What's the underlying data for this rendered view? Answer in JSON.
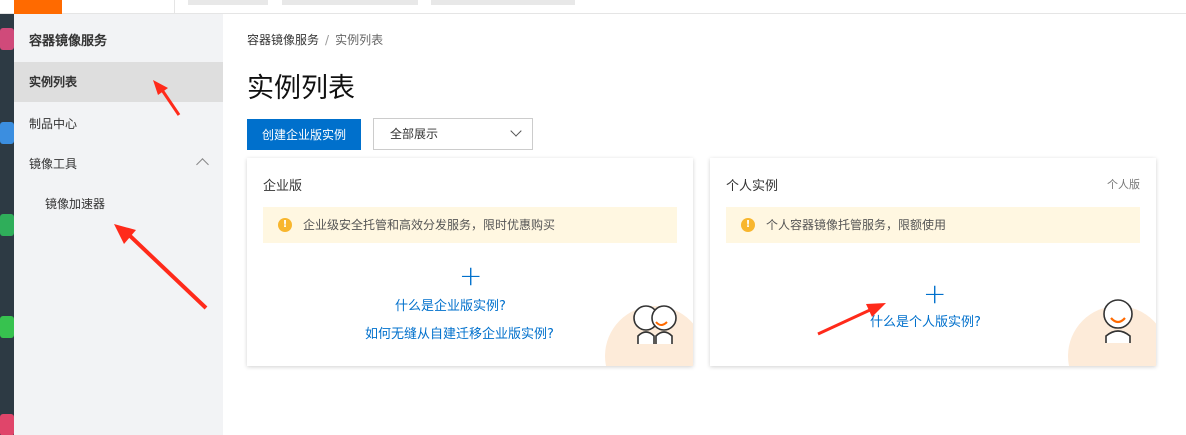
{
  "sidebar": {
    "title": "容器镜像服务",
    "items": [
      {
        "label": "实例列表",
        "active": true
      },
      {
        "label": "制品中心"
      },
      {
        "label": "镜像工具",
        "expanded": true
      },
      {
        "label": "镜像加速器",
        "sub": true
      }
    ]
  },
  "breadcrumb": {
    "root": "容器镜像服务",
    "current": "实例列表"
  },
  "page": {
    "title": "实例列表"
  },
  "toolbar": {
    "create_label": "创建企业版实例",
    "filter_value": "全部展示"
  },
  "cards": {
    "enterprise": {
      "title": "企业版",
      "notice": "企业级安全托管和高效分发服务，限时优惠购买",
      "links": [
        "什么是企业版实例?",
        "如何无缝从自建迁移企业版实例?"
      ]
    },
    "personal": {
      "title": "个人实例",
      "tag": "个人版",
      "notice": "个人容器镜像托管服务，限额使用",
      "links": [
        "什么是个人版实例?"
      ]
    }
  },
  "colors": {
    "primary": "#0070cc",
    "brand": "#ff6a00",
    "notice_bg": "#fff7e1",
    "annotation": "#ff2a1a"
  }
}
